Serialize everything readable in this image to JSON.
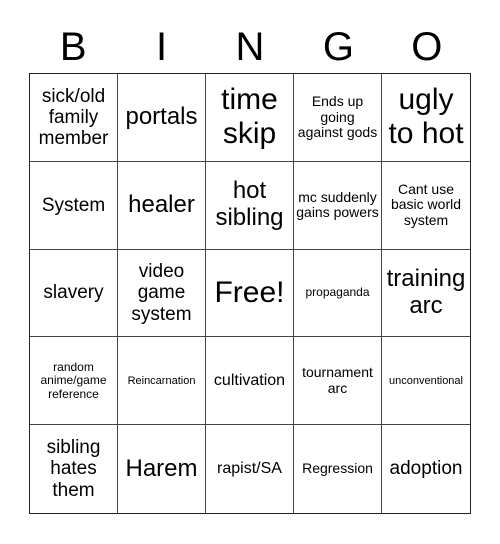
{
  "header": {
    "letters": [
      "B",
      "I",
      "N",
      "G",
      "O"
    ]
  },
  "cells": [
    "sick/old family member",
    "portals",
    "time skip",
    "Ends up going against gods",
    "ugly to hot",
    "System",
    "healer",
    "hot sibling",
    "mc suddenly gains powers",
    "Cant use basic world system",
    "slavery",
    "video game system",
    "Free!",
    "propaganda",
    "training arc",
    "random anime/game reference",
    "Reincarnation",
    "cultivation",
    "tournament arc",
    "unconventional",
    "sibling hates them",
    "Harem",
    "rapist/SA",
    "Regression",
    "adoption"
  ]
}
